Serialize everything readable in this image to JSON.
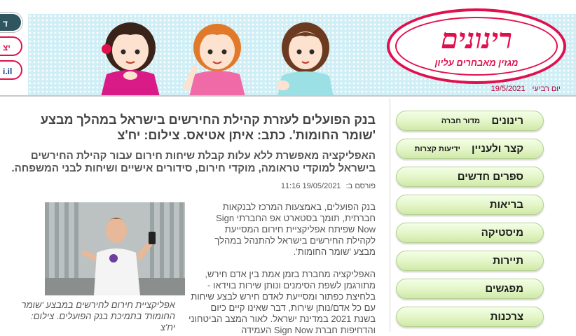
{
  "header": {
    "logo_main": "רינונים",
    "logo_tagline": "מגזין מאבחרים עליון",
    "day_label": "יום רביעי",
    "date": "19/5/2021"
  },
  "side_tabs": [
    "ד",
    "יצ",
    "i.il"
  ],
  "sidebar": {
    "items": [
      {
        "label": "רינונים",
        "sub": "מדור חברה"
      },
      {
        "label": "קצר ולעניין",
        "sub": "ידיעות קצרות"
      },
      {
        "label": "ספרים חדשים",
        "sub": ""
      },
      {
        "label": "בריאות",
        "sub": ""
      },
      {
        "label": "מיסטיקה",
        "sub": ""
      },
      {
        "label": "תיירות",
        "sub": ""
      },
      {
        "label": "מפגשים",
        "sub": ""
      },
      {
        "label": "צרכנות",
        "sub": ""
      }
    ]
  },
  "article": {
    "headline": "בנק הפועלים לעזרת קהילת החירשים בישראל במהלך מבצע 'שומר החומות'. כתב: איתן אטיאס. צילום: יח'צ",
    "lead": "האפליקציה מאפשרת ללא עלות קבלת שיחות חירום עבור קהילת החירשים בישראל למוקדי טראומה, מוקדי חירום, סידורים אישיים ושיחות לבני המשפחה.",
    "published_label": "פורסם ב:",
    "published_value": "19/05/2021 11:16",
    "para1": "בנק הפועלים, באמצעות המרכז לבנקאות חברתית, תומך בסטארט אפ החברתי Sign Now שפיתח אפליקציית חירום המסייעת לקהילת החירשים בישראל להתנהל במהלך מבצע 'שומר החומות'.",
    "para2": "האפליקציה מחברת בזמן אמת בין אדם חירש, מתורגמן לשפת הסימנים ונותן שירות בוידאו - בלחיצת כפתור ומסייעת לאדם חירש לבצע שיחות עם כל אדם/נותן שירות, דבר שאינו קיים כיום בשנת 2021 במדינת ישראל. לאור המצב הביטחוני והדחיפות חברת Sign Now העמידה",
    "photo_caption": "אפליקציית חירום לחירשים במבצע 'שומר החומות' בתמיכת בנק הפועלים. צילום: יח'צ"
  },
  "colors": {
    "brand": "#e0104e",
    "header_band": "#cfeef5",
    "nav_pill": "#e2f5c6",
    "text": "#555555"
  }
}
